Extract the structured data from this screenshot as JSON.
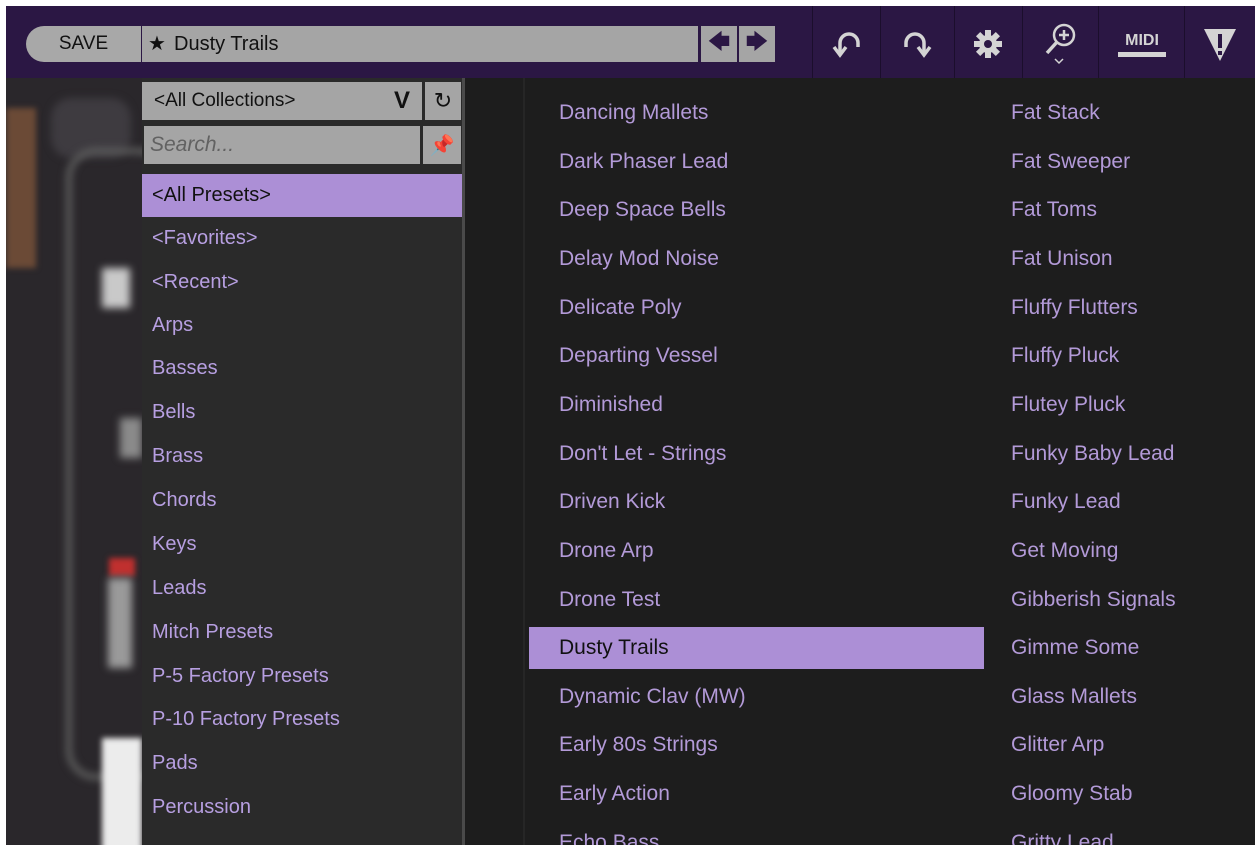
{
  "toolbar": {
    "save_label": "SAVE",
    "current_preset": "Dusty Trails",
    "icons": [
      "star-icon",
      "arrow-left-icon",
      "arrow-right-icon",
      "undo-icon",
      "redo-icon",
      "gear-icon",
      "zoom-icon",
      "midi-icon",
      "warning-icon"
    ],
    "midi_label": "MIDI"
  },
  "collections": {
    "selected": "<All Collections>",
    "search_placeholder": "Search...",
    "items": [
      "<All Presets>",
      "<Favorites>",
      "<Recent>",
      "Arps",
      "Basses",
      "Bells",
      "Brass",
      "Chords",
      "Keys",
      "Leads",
      "Mitch Presets",
      "P-5 Factory Presets",
      "P-10 Factory Presets",
      "Pads",
      "Percussion"
    ],
    "selected_index": 0
  },
  "presets": {
    "column1": [
      "Dancing Mallets",
      "Dark Phaser Lead",
      "Deep Space Bells",
      "Delay Mod Noise",
      "Delicate Poly",
      "Departing Vessel",
      "Diminished",
      "Don't Let - Strings",
      "Driven Kick",
      "Drone Arp",
      "Drone Test",
      "Dusty Trails",
      "Dynamic Clav (MW)",
      "Early 80s Strings",
      "Early Action",
      "Echo Bass"
    ],
    "column2": [
      "Fat Stack",
      "Fat Sweeper",
      "Fat Toms",
      "Fat Unison",
      "Fluffy Flutters",
      "Fluffy Pluck",
      "Flutey Pluck",
      "Funky Baby Lead",
      "Funky Lead",
      "Get Moving",
      "Gibberish Signals",
      "Gimme Some",
      "Glass Mallets",
      "Glitter Arp",
      "Gloomy Stab",
      "Gritty Lead"
    ],
    "selected": "Dusty Trails"
  },
  "colors": {
    "toolbar_bg": "#2b1744",
    "field_bg": "#a5a5a5",
    "accent": "#ac8fd6",
    "item_text": "#b39ad8",
    "panel_bg": "#1d1d1d"
  }
}
